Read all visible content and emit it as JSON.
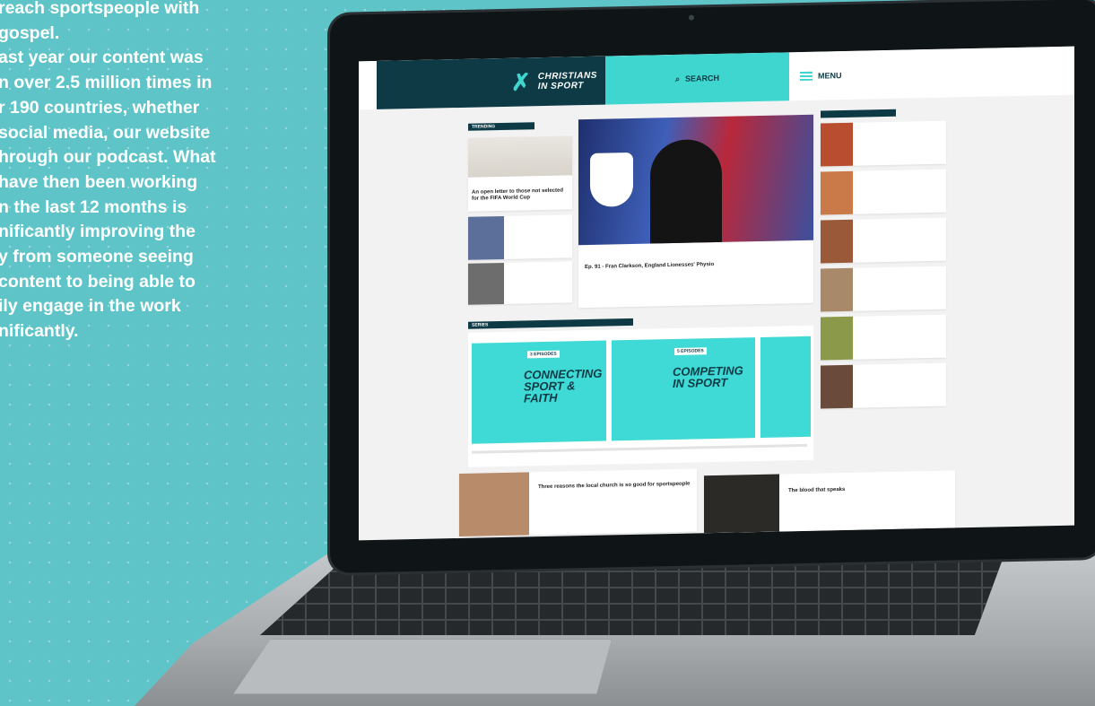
{
  "marketing_copy": {
    "lines": [
      "reach sportspeople with",
      "gospel.",
      "ast year our content was",
      "n over 2.5 million times in",
      "r 190 countries, whether",
      "social media, our website",
      "hrough our podcast. What",
      "have then been working",
      "n the last 12 months is",
      "nificantly improving the",
      "y from someone seeing",
      "content to being able to",
      "ily engage in the work",
      "nificantly."
    ]
  },
  "site": {
    "logo_text": "CHRISTIANS IN SPORT",
    "search_label": "SEARCH",
    "menu_label": "MENU",
    "colors": {
      "dark": "#0d3a44",
      "accent": "#40d6d0"
    },
    "trending": {
      "heading": "TRENDING",
      "feature_title": "An open letter to those not selected for the FIFA World Cup"
    },
    "hero": {
      "title": "Ep. 91 - Fran Clarkson, England Lionesses' Physio"
    },
    "series": {
      "heading": "SERIES",
      "tiles": [
        {
          "label": "3 EPISODES",
          "title": "CONNECTING SPORT & FAITH"
        },
        {
          "label": "5 EPISODES",
          "title": "COMPETING IN SPORT"
        }
      ]
    },
    "bottom_cards": [
      {
        "title": "Three reasons the local church is so good for sportspeople"
      },
      {
        "title": "The blood that speaks"
      }
    ]
  }
}
